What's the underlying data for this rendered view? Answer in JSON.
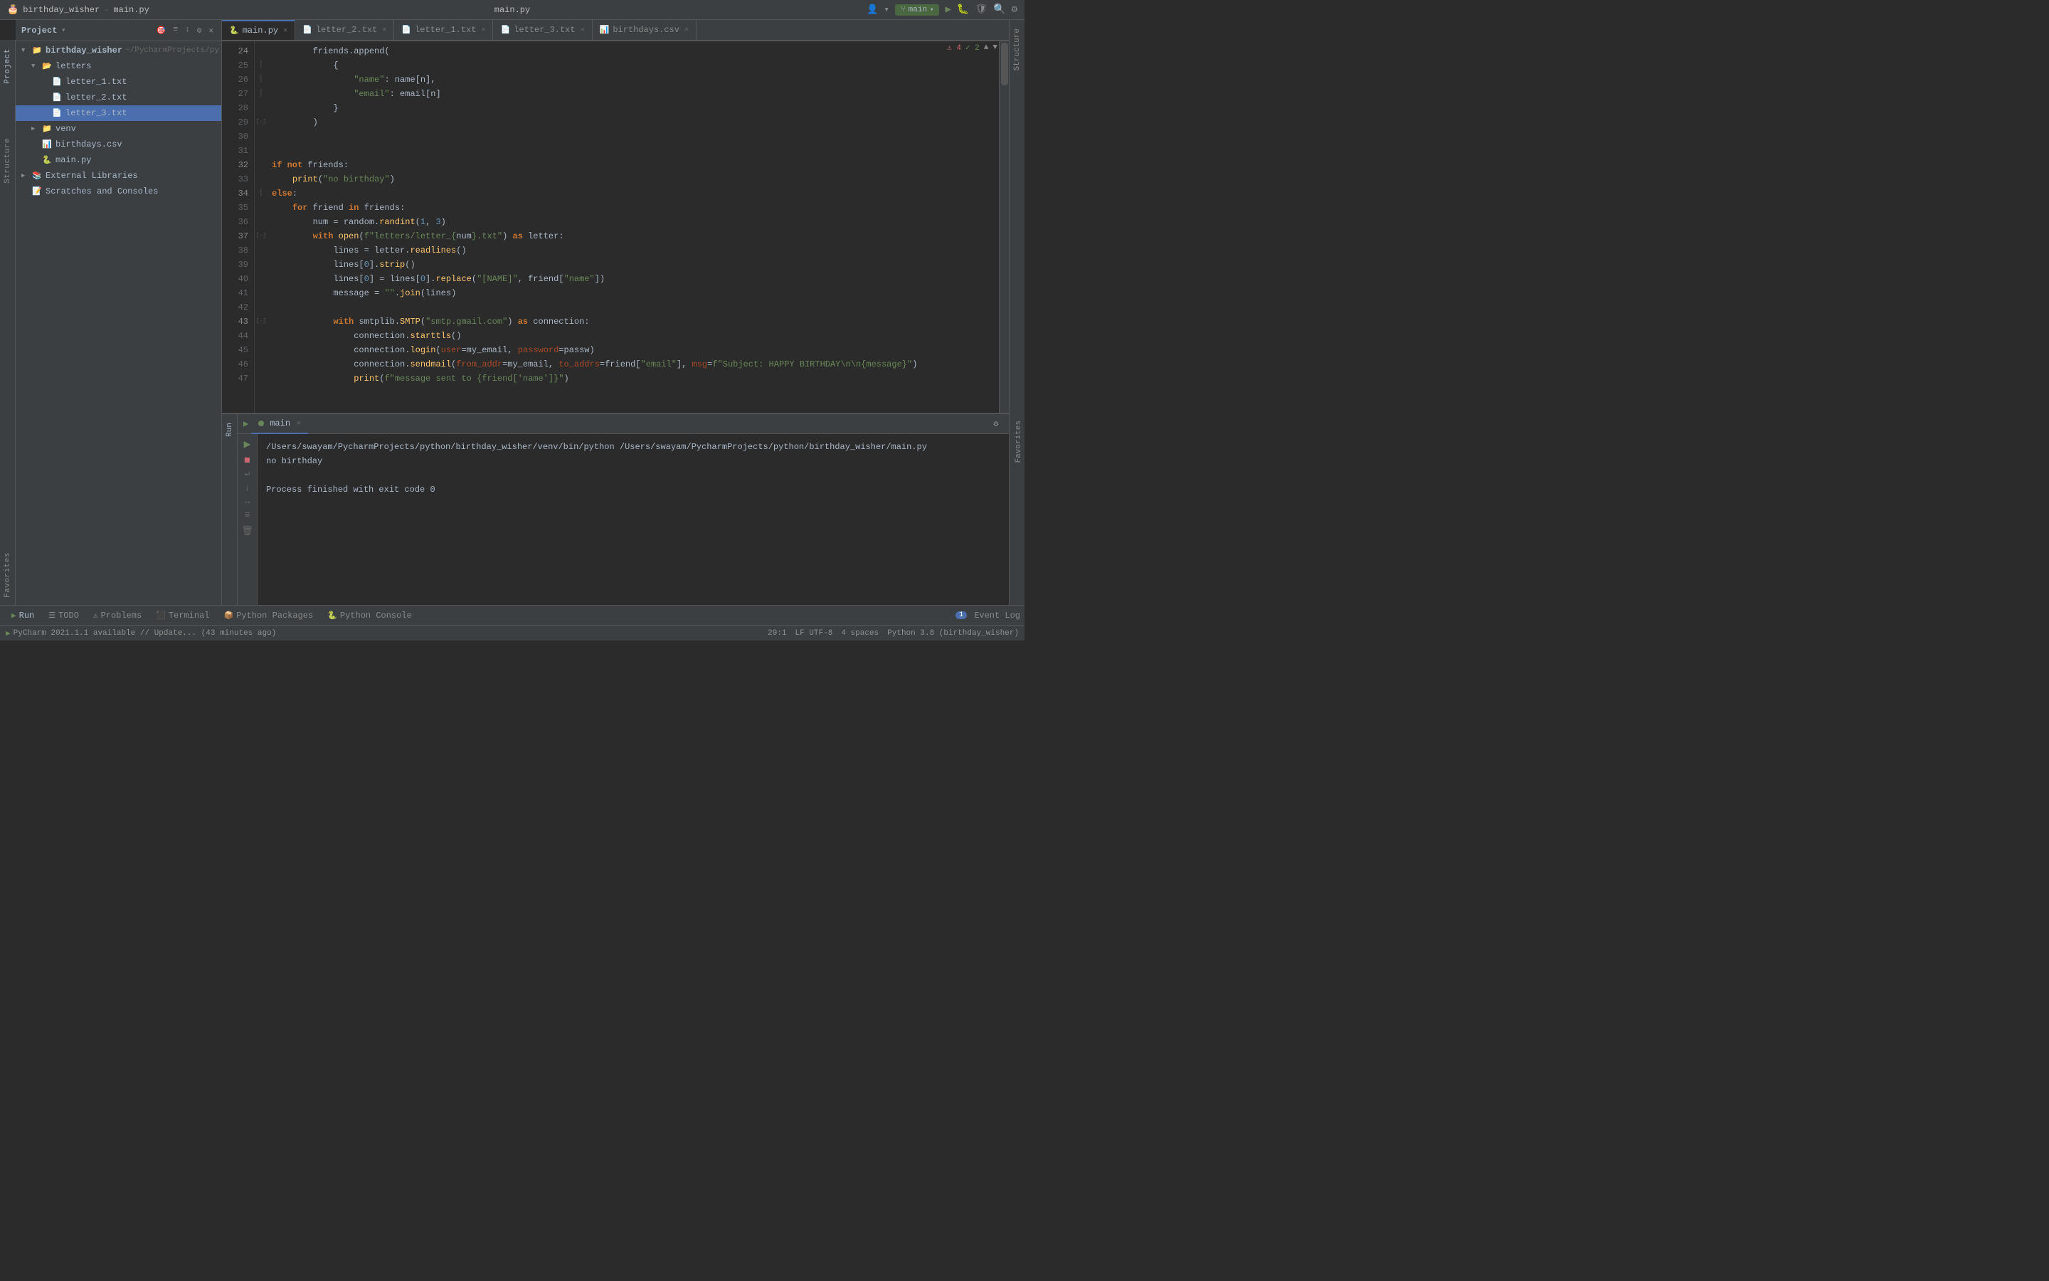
{
  "titlebar": {
    "file": "birthday_wisher",
    "filename": "main.py",
    "branch": "main",
    "search_icon": "🔍"
  },
  "tabs": [
    {
      "name": "main.py",
      "type": "py",
      "active": true
    },
    {
      "name": "letter_2.txt",
      "type": "txt",
      "active": false
    },
    {
      "name": "letter_1.txt",
      "type": "txt",
      "active": false
    },
    {
      "name": "letter_3.txt",
      "type": "txt",
      "active": false
    },
    {
      "name": "birthdays.csv",
      "type": "csv",
      "active": false
    }
  ],
  "project": {
    "header": "Project",
    "root": "birthday_wisher",
    "root_path": "~/PycharmProjects/py",
    "items": [
      {
        "label": "birthday_wisher",
        "type": "project-root",
        "depth": 0,
        "expanded": true
      },
      {
        "label": "letters",
        "type": "folder",
        "depth": 1,
        "expanded": true
      },
      {
        "label": "letter_1.txt",
        "type": "txt",
        "depth": 2
      },
      {
        "label": "letter_2.txt",
        "type": "txt",
        "depth": 2
      },
      {
        "label": "letter_3.txt",
        "type": "txt",
        "depth": 2,
        "selected": true
      },
      {
        "label": "venv",
        "type": "folder",
        "depth": 1,
        "expanded": false
      },
      {
        "label": "birthdays.csv",
        "type": "csv",
        "depth": 1
      },
      {
        "label": "main.py",
        "type": "py",
        "depth": 1
      },
      {
        "label": "External Libraries",
        "type": "ext-lib",
        "depth": 0,
        "expanded": false
      },
      {
        "label": "Scratches and Consoles",
        "type": "scratch",
        "depth": 0
      }
    ]
  },
  "code": {
    "lines": [
      {
        "num": 24,
        "content": "        friends.append("
      },
      {
        "num": 25,
        "content": "            {"
      },
      {
        "num": 26,
        "content": "                \"name\": name[n],"
      },
      {
        "num": 27,
        "content": "                \"email\": email[n]"
      },
      {
        "num": 28,
        "content": "            }"
      },
      {
        "num": 29,
        "content": "        )"
      },
      {
        "num": 30,
        "content": ""
      },
      {
        "num": 31,
        "content": ""
      },
      {
        "num": 32,
        "content": "if not friends:"
      },
      {
        "num": 33,
        "content": "    print(\"no birthday\")"
      },
      {
        "num": 34,
        "content": "else:"
      },
      {
        "num": 35,
        "content": "    for friend in friends:"
      },
      {
        "num": 36,
        "content": "        num = random.randint(1, 3)"
      },
      {
        "num": 37,
        "content": "        with open(f\"letters/letter_{num}.txt\") as letter:"
      },
      {
        "num": 38,
        "content": "            lines = letter.readlines()"
      },
      {
        "num": 39,
        "content": "            lines[0].strip()"
      },
      {
        "num": 40,
        "content": "            lines[0] = lines[0].replace(\"[NAME]\", friend[\"name\"])"
      },
      {
        "num": 41,
        "content": "            message = \"\".join(lines)"
      },
      {
        "num": 42,
        "content": ""
      },
      {
        "num": 43,
        "content": "            with smtplib.SMTP(\"smtp.gmail.com\") as connection:"
      },
      {
        "num": 44,
        "content": "                connection.starttls()"
      },
      {
        "num": 45,
        "content": "                connection.login(user=my_email, password=passw)"
      },
      {
        "num": 46,
        "content": "                connection.sendmail(from_addr=my_email, to_addrs=friend[\"email\"], msg=f\"Subject: HAPPY BIRTHDAY\\n\\n{message}\")"
      },
      {
        "num": 47,
        "content": "                print(f\"message sent to {friend['name']}\")"
      }
    ]
  },
  "run": {
    "tab_label": "main",
    "command": "/Users/swayam/PycharmProjects/python/birthday_wisher/venv/bin/python /Users/swayam/PycharmProjects/python/birthday_wisher/main.py",
    "output1": "no birthday",
    "output2": "",
    "output3": "Process finished with exit code 0"
  },
  "bottom_tools": [
    {
      "icon": "▶",
      "label": "Run",
      "active": false
    },
    {
      "icon": "≡",
      "label": "TODO",
      "active": false
    },
    {
      "icon": "⚠",
      "label": "Problems",
      "active": false
    },
    {
      "icon": "⬛",
      "label": "Terminal",
      "active": false
    },
    {
      "icon": "📦",
      "label": "Python Packages",
      "active": false
    },
    {
      "icon": "🐍",
      "label": "Python Console",
      "active": false
    }
  ],
  "status_bar": {
    "pycharm": "PyCharm 2021.1.1 available // Update... (43 minutes ago)",
    "position": "29:1",
    "encoding": "LF  UTF-8",
    "indent": "4 spaces",
    "interpreter": "Python 3.8 (birthday_wisher)",
    "event_log": "Event Log",
    "event_count": "1"
  },
  "error_indicator": {
    "errors": "4",
    "warnings": "2"
  }
}
